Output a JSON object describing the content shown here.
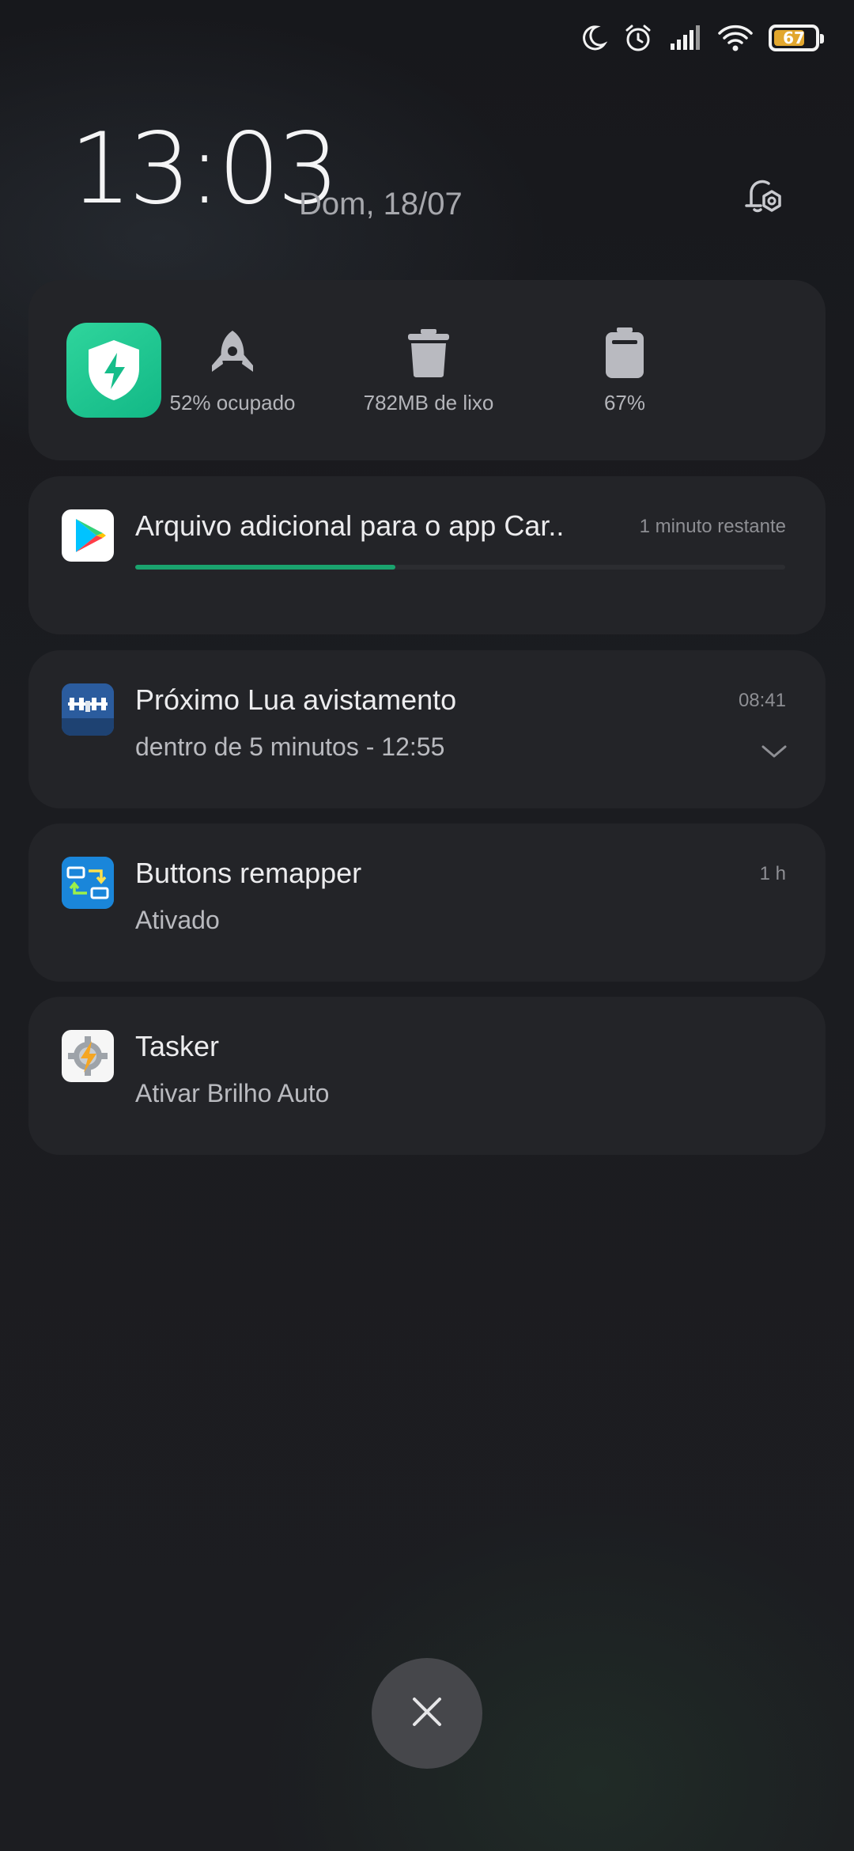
{
  "status_bar": {
    "icons": [
      "moon-icon",
      "alarm-icon",
      "signal-icon",
      "wifi-icon",
      "battery-icon"
    ],
    "battery_level": "67"
  },
  "header": {
    "time": "13:03",
    "date": "Dom, 18/07",
    "settings_icon": "notification-settings-icon"
  },
  "quick_panel": {
    "app_icon": "security-shield-icon",
    "items": [
      {
        "icon": "rocket-icon",
        "label": "52% ocupado"
      },
      {
        "icon": "trash-icon",
        "label": "782MB de lixo"
      },
      {
        "icon": "battery-icon",
        "label": "67%"
      }
    ]
  },
  "notifications": [
    {
      "app_icon": "play-store-icon",
      "title": "Arquivo adicional para o app Car..",
      "time": "1 minuto restante",
      "progress": 0.4
    },
    {
      "app_icon": "iss-detector-icon",
      "title": "Próximo Lua avistamento",
      "text": "dentro de 5 minutos - 12:55",
      "time": "08:41",
      "expand_icon": "chevron-down-icon"
    },
    {
      "app_icon": "buttons-remapper-icon",
      "title": "Buttons remapper",
      "text": "Ativado",
      "time": "1 h"
    },
    {
      "app_icon": "tasker-icon",
      "title": "Tasker",
      "text": "Ativar Brilho Auto"
    }
  ],
  "dismiss": {
    "icon": "close-icon"
  },
  "colors": {
    "accent_green": "#1aa36e",
    "card_bg": "#232428",
    "battery_fill": "#e2a72e"
  }
}
